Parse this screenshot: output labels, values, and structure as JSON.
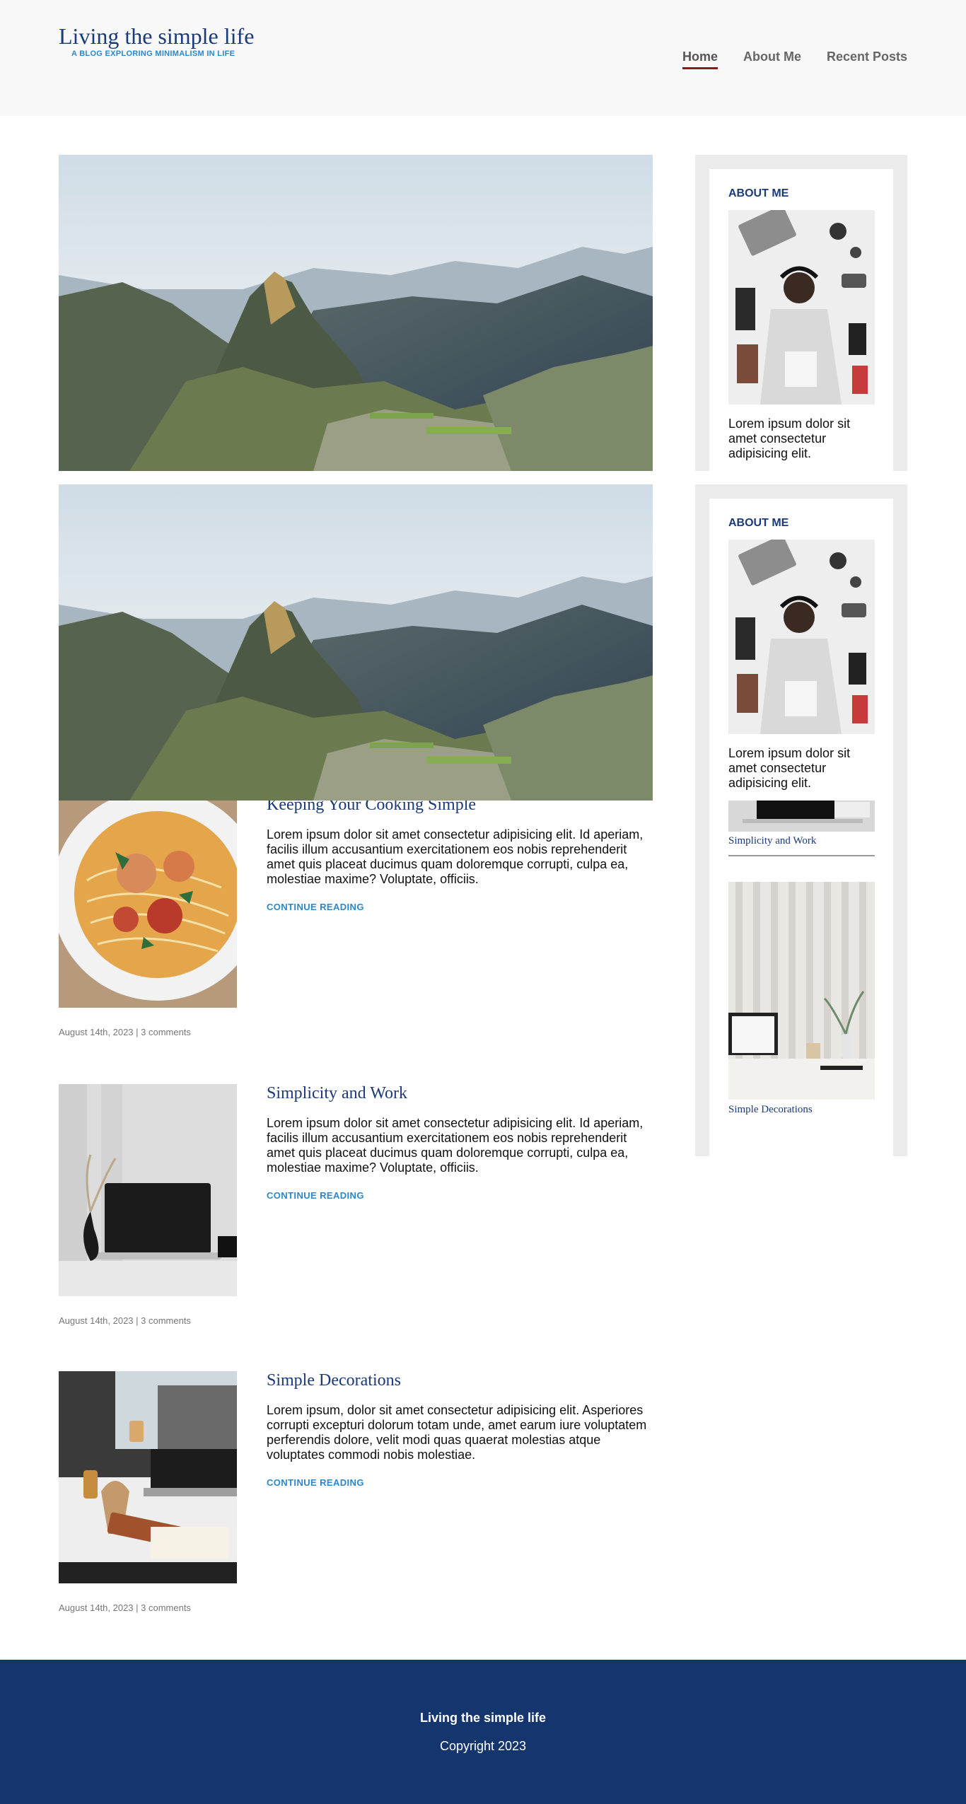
{
  "header": {
    "title": "Living the simple life",
    "tagline": "A BLOG EXPLORING MINIMALISM IN LIFE",
    "nav": [
      {
        "label": "Home",
        "active": true
      },
      {
        "label": "About Me",
        "active": false
      },
      {
        "label": "Recent Posts",
        "active": false
      }
    ]
  },
  "sidebar": {
    "about": {
      "title": "ABOUT ME",
      "text": "Lorem ipsum dolor sit amet consectetur adipisicing elit."
    },
    "recent_posts": [
      {
        "title": "Simplicity and Work"
      },
      {
        "title": "Simple Decorations"
      }
    ]
  },
  "posts": [
    {
      "title": "Keeping Your Cooking Simple",
      "excerpt": "Lorem ipsum dolor sit amet consectetur adipisicing elit. Id aperiam, facilis illum accusantium exercitationem eos nobis reprehenderit amet quis placeat ducimus quam doloremque corrupti, culpa ea, molestiae maxime? Voluptate, officiis.",
      "more": "CONTINUE READING",
      "meta": "August 14th, 2023 | 3 comments"
    },
    {
      "title": "Simplicity and Work",
      "excerpt": "Lorem ipsum dolor sit amet consectetur adipisicing elit. Id aperiam, facilis illum accusantium exercitationem eos nobis reprehenderit amet quis placeat ducimus quam doloremque corrupti, culpa ea, molestiae maxime? Voluptate, officiis.",
      "more": "CONTINUE READING",
      "meta": "August 14th, 2023 | 3 comments"
    },
    {
      "title": "Simple Decorations",
      "excerpt": "Lorem ipsum, dolor sit amet consectetur adipisicing elit. Asperiores corrupti excepturi dolorum totam unde, amet earum iure voluptatem perferendis dolore, velit modi quas quaerat molestias atque voluptates commodi nobis molestiae.",
      "more": "CONTINUE READING",
      "meta": "August 14th, 2023 | 3 comments"
    }
  ],
  "footer": {
    "title": "Living the simple life",
    "copyright": "Copyright 2023"
  },
  "colors": {
    "brand": "#1a3a78",
    "accent": "#2e87c9",
    "footer_bg": "#15356f",
    "nav_active_underline": "#8b1a1a"
  }
}
